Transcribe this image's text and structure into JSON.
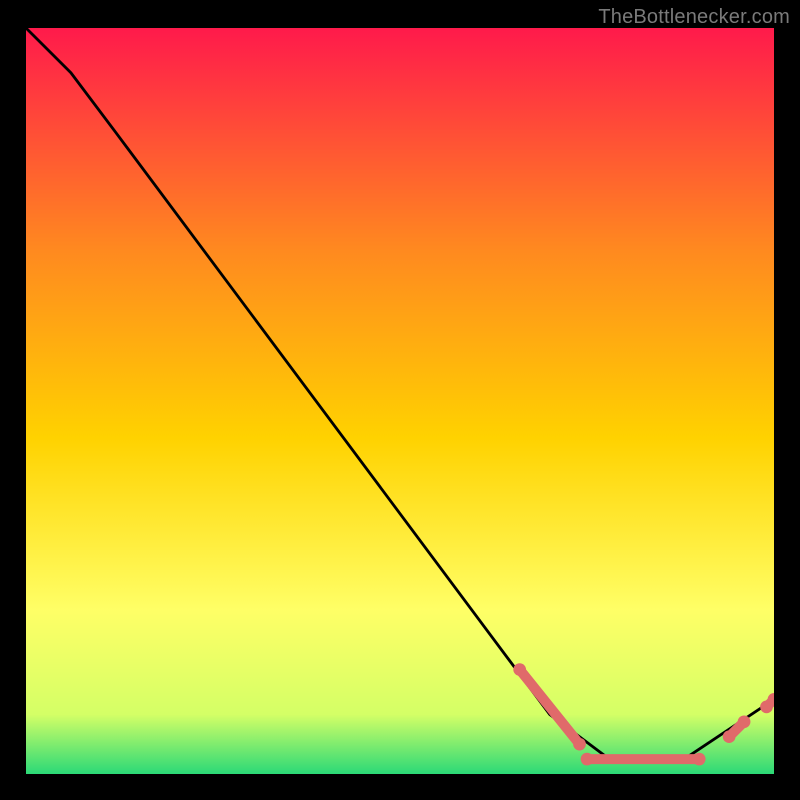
{
  "attribution": "TheBottlenecker.com",
  "chart_data": {
    "type": "line",
    "title": "",
    "xlabel": "",
    "ylabel": "",
    "xlim": [
      0,
      100
    ],
    "ylim": [
      0,
      100
    ],
    "curve": [
      {
        "x": 0,
        "y": 100
      },
      {
        "x": 6,
        "y": 94
      },
      {
        "x": 12,
        "y": 86
      },
      {
        "x": 70,
        "y": 8
      },
      {
        "x": 78,
        "y": 2
      },
      {
        "x": 88,
        "y": 2
      },
      {
        "x": 100,
        "y": 10
      }
    ],
    "highlight_segments": [
      {
        "x0": 66,
        "y0": 14,
        "x1": 74,
        "y1": 4
      },
      {
        "x0": 75,
        "y0": 2,
        "x1": 90,
        "y1": 2
      },
      {
        "x0": 94,
        "y0": 5,
        "x1": 96,
        "y1": 7
      },
      {
        "x0": 99,
        "y0": 9,
        "x1": 100,
        "y1": 10
      }
    ],
    "highlight_endpoints": [
      {
        "x": 66,
        "y": 14
      },
      {
        "x": 74,
        "y": 4
      },
      {
        "x": 75,
        "y": 2
      },
      {
        "x": 90,
        "y": 2
      },
      {
        "x": 94,
        "y": 5
      },
      {
        "x": 96,
        "y": 7
      },
      {
        "x": 99,
        "y": 9
      },
      {
        "x": 100,
        "y": 10
      }
    ],
    "colors": {
      "gradient_top": "#ff1a4b",
      "gradient_mid_upper": "#ff8a1f",
      "gradient_mid": "#ffd200",
      "gradient_mid_lower": "#ffff66",
      "gradient_near_bottom": "#d4ff66",
      "gradient_bottom": "#2bd977",
      "curve": "#000000",
      "highlight": "#e06a6a"
    }
  }
}
